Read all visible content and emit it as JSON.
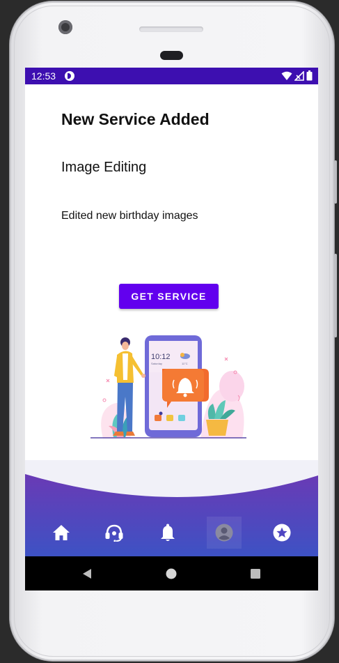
{
  "status_bar": {
    "time": "12:53",
    "app_icon": "circle-p-icon",
    "icons": [
      "wifi-icon",
      "signal-icon",
      "battery-icon"
    ],
    "background_color": "#3d0fb0"
  },
  "content": {
    "title": "New Service Added",
    "service_name": "Image Editing",
    "description": "Edited new birthday images",
    "action_button_label": "GET SERVICE",
    "button_color": "#6200ee",
    "illustration": {
      "phone_time": "10:12",
      "phone_date": "Saturday",
      "phone_temp": "11°C"
    }
  },
  "bottom_nav": {
    "gradient_colors": [
      "#6a3ab5",
      "#3d52c4"
    ],
    "items": [
      {
        "icon": "home-icon",
        "selected": false
      },
      {
        "icon": "headset-icon",
        "selected": false
      },
      {
        "icon": "bell-icon",
        "selected": false
      },
      {
        "icon": "account-icon",
        "selected": true
      },
      {
        "icon": "star-circle-icon",
        "selected": false
      }
    ]
  },
  "system_nav": {
    "buttons": [
      "back-icon",
      "home-circle-icon",
      "recents-icon"
    ]
  }
}
